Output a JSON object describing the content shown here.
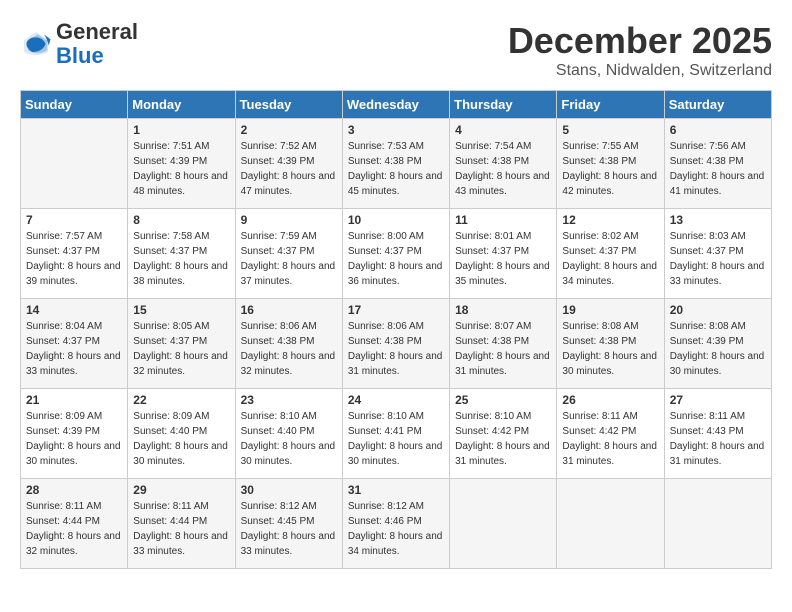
{
  "header": {
    "logo_general": "General",
    "logo_blue": "Blue",
    "month_title": "December 2025",
    "subtitle": "Stans, Nidwalden, Switzerland"
  },
  "days_of_week": [
    "Sunday",
    "Monday",
    "Tuesday",
    "Wednesday",
    "Thursday",
    "Friday",
    "Saturday"
  ],
  "weeks": [
    [
      {
        "day": "",
        "sunrise": "",
        "sunset": "",
        "daylight": ""
      },
      {
        "day": "1",
        "sunrise": "Sunrise: 7:51 AM",
        "sunset": "Sunset: 4:39 PM",
        "daylight": "Daylight: 8 hours and 48 minutes."
      },
      {
        "day": "2",
        "sunrise": "Sunrise: 7:52 AM",
        "sunset": "Sunset: 4:39 PM",
        "daylight": "Daylight: 8 hours and 47 minutes."
      },
      {
        "day": "3",
        "sunrise": "Sunrise: 7:53 AM",
        "sunset": "Sunset: 4:38 PM",
        "daylight": "Daylight: 8 hours and 45 minutes."
      },
      {
        "day": "4",
        "sunrise": "Sunrise: 7:54 AM",
        "sunset": "Sunset: 4:38 PM",
        "daylight": "Daylight: 8 hours and 43 minutes."
      },
      {
        "day": "5",
        "sunrise": "Sunrise: 7:55 AM",
        "sunset": "Sunset: 4:38 PM",
        "daylight": "Daylight: 8 hours and 42 minutes."
      },
      {
        "day": "6",
        "sunrise": "Sunrise: 7:56 AM",
        "sunset": "Sunset: 4:38 PM",
        "daylight": "Daylight: 8 hours and 41 minutes."
      }
    ],
    [
      {
        "day": "7",
        "sunrise": "Sunrise: 7:57 AM",
        "sunset": "Sunset: 4:37 PM",
        "daylight": "Daylight: 8 hours and 39 minutes."
      },
      {
        "day": "8",
        "sunrise": "Sunrise: 7:58 AM",
        "sunset": "Sunset: 4:37 PM",
        "daylight": "Daylight: 8 hours and 38 minutes."
      },
      {
        "day": "9",
        "sunrise": "Sunrise: 7:59 AM",
        "sunset": "Sunset: 4:37 PM",
        "daylight": "Daylight: 8 hours and 37 minutes."
      },
      {
        "day": "10",
        "sunrise": "Sunrise: 8:00 AM",
        "sunset": "Sunset: 4:37 PM",
        "daylight": "Daylight: 8 hours and 36 minutes."
      },
      {
        "day": "11",
        "sunrise": "Sunrise: 8:01 AM",
        "sunset": "Sunset: 4:37 PM",
        "daylight": "Daylight: 8 hours and 35 minutes."
      },
      {
        "day": "12",
        "sunrise": "Sunrise: 8:02 AM",
        "sunset": "Sunset: 4:37 PM",
        "daylight": "Daylight: 8 hours and 34 minutes."
      },
      {
        "day": "13",
        "sunrise": "Sunrise: 8:03 AM",
        "sunset": "Sunset: 4:37 PM",
        "daylight": "Daylight: 8 hours and 33 minutes."
      }
    ],
    [
      {
        "day": "14",
        "sunrise": "Sunrise: 8:04 AM",
        "sunset": "Sunset: 4:37 PM",
        "daylight": "Daylight: 8 hours and 33 minutes."
      },
      {
        "day": "15",
        "sunrise": "Sunrise: 8:05 AM",
        "sunset": "Sunset: 4:37 PM",
        "daylight": "Daylight: 8 hours and 32 minutes."
      },
      {
        "day": "16",
        "sunrise": "Sunrise: 8:06 AM",
        "sunset": "Sunset: 4:38 PM",
        "daylight": "Daylight: 8 hours and 32 minutes."
      },
      {
        "day": "17",
        "sunrise": "Sunrise: 8:06 AM",
        "sunset": "Sunset: 4:38 PM",
        "daylight": "Daylight: 8 hours and 31 minutes."
      },
      {
        "day": "18",
        "sunrise": "Sunrise: 8:07 AM",
        "sunset": "Sunset: 4:38 PM",
        "daylight": "Daylight: 8 hours and 31 minutes."
      },
      {
        "day": "19",
        "sunrise": "Sunrise: 8:08 AM",
        "sunset": "Sunset: 4:38 PM",
        "daylight": "Daylight: 8 hours and 30 minutes."
      },
      {
        "day": "20",
        "sunrise": "Sunrise: 8:08 AM",
        "sunset": "Sunset: 4:39 PM",
        "daylight": "Daylight: 8 hours and 30 minutes."
      }
    ],
    [
      {
        "day": "21",
        "sunrise": "Sunrise: 8:09 AM",
        "sunset": "Sunset: 4:39 PM",
        "daylight": "Daylight: 8 hours and 30 minutes."
      },
      {
        "day": "22",
        "sunrise": "Sunrise: 8:09 AM",
        "sunset": "Sunset: 4:40 PM",
        "daylight": "Daylight: 8 hours and 30 minutes."
      },
      {
        "day": "23",
        "sunrise": "Sunrise: 8:10 AM",
        "sunset": "Sunset: 4:40 PM",
        "daylight": "Daylight: 8 hours and 30 minutes."
      },
      {
        "day": "24",
        "sunrise": "Sunrise: 8:10 AM",
        "sunset": "Sunset: 4:41 PM",
        "daylight": "Daylight: 8 hours and 30 minutes."
      },
      {
        "day": "25",
        "sunrise": "Sunrise: 8:10 AM",
        "sunset": "Sunset: 4:42 PM",
        "daylight": "Daylight: 8 hours and 31 minutes."
      },
      {
        "day": "26",
        "sunrise": "Sunrise: 8:11 AM",
        "sunset": "Sunset: 4:42 PM",
        "daylight": "Daylight: 8 hours and 31 minutes."
      },
      {
        "day": "27",
        "sunrise": "Sunrise: 8:11 AM",
        "sunset": "Sunset: 4:43 PM",
        "daylight": "Daylight: 8 hours and 31 minutes."
      }
    ],
    [
      {
        "day": "28",
        "sunrise": "Sunrise: 8:11 AM",
        "sunset": "Sunset: 4:44 PM",
        "daylight": "Daylight: 8 hours and 32 minutes."
      },
      {
        "day": "29",
        "sunrise": "Sunrise: 8:11 AM",
        "sunset": "Sunset: 4:44 PM",
        "daylight": "Daylight: 8 hours and 33 minutes."
      },
      {
        "day": "30",
        "sunrise": "Sunrise: 8:12 AM",
        "sunset": "Sunset: 4:45 PM",
        "daylight": "Daylight: 8 hours and 33 minutes."
      },
      {
        "day": "31",
        "sunrise": "Sunrise: 8:12 AM",
        "sunset": "Sunset: 4:46 PM",
        "daylight": "Daylight: 8 hours and 34 minutes."
      },
      {
        "day": "",
        "sunrise": "",
        "sunset": "",
        "daylight": ""
      },
      {
        "day": "",
        "sunrise": "",
        "sunset": "",
        "daylight": ""
      },
      {
        "day": "",
        "sunrise": "",
        "sunset": "",
        "daylight": ""
      }
    ]
  ]
}
